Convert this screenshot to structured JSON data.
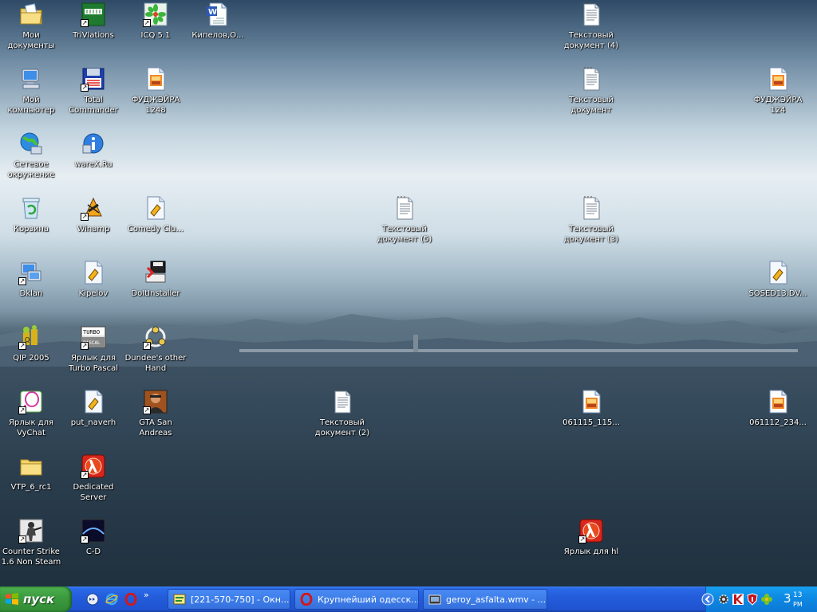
{
  "desktop": {
    "icons": [
      {
        "label": "Мои\nдокументы",
        "icon": "my-documents-icon",
        "shortcut": false
      },
      {
        "label": "Мой\nкомпьютер",
        "icon": "my-computer-icon",
        "shortcut": false
      },
      {
        "label": "Сетевое\nокружение",
        "icon": "network-places-icon",
        "shortcut": false
      },
      {
        "label": "Корзина",
        "icon": "recycle-bin-icon",
        "shortcut": false
      },
      {
        "label": "Dklan",
        "icon": "network-app-icon",
        "shortcut": true
      },
      {
        "label": "QIP 2005",
        "icon": "qip-icon",
        "shortcut": true
      },
      {
        "label": "Ярлык для\nVyChat",
        "icon": "vychat-icon",
        "shortcut": true
      },
      {
        "label": "VTP_6_rc1",
        "icon": "folder-icon",
        "shortcut": false
      },
      {
        "label": "Counter Strike\n1.6 Non Steam",
        "icon": "counter-strike-icon",
        "shortcut": true
      },
      {
        "label": "TriVlations",
        "icon": "trivlations-icon",
        "shortcut": true
      },
      {
        "label": "Total\nCommander",
        "icon": "total-commander-icon",
        "shortcut": true
      },
      {
        "label": "wareX.Ru",
        "icon": "info-globe-icon",
        "shortcut": false
      },
      {
        "label": "Winamp",
        "icon": "winamp-icon",
        "shortcut": true
      },
      {
        "label": "Kipelov",
        "icon": "media-file-icon",
        "shortcut": false
      },
      {
        "label": "Ярлык для\nTurbo Pascal",
        "icon": "turbo-pascal-icon",
        "shortcut": true
      },
      {
        "label": "put_naverh",
        "icon": "media-file-icon",
        "shortcut": false
      },
      {
        "label": "Dedicated\nServer",
        "icon": "half-life-icon",
        "shortcut": true
      },
      {
        "label": "C-D",
        "icon": "c-d-icon",
        "shortcut": true
      },
      {
        "label": "ICQ 5.1",
        "icon": "icq-icon",
        "shortcut": true
      },
      {
        "label": "ФУДЖЭЙРА\n1248",
        "icon": "image-file-icon",
        "shortcut": false
      },
      {
        "label": "Comedy Clu...",
        "icon": "media-file-icon",
        "shortcut": false
      },
      {
        "label": "DoItInstaller",
        "icon": "installer-icon",
        "shortcut": false
      },
      {
        "label": "Dundee's other\nHand",
        "icon": "dundee-icon",
        "shortcut": true
      },
      {
        "label": "GTA San\nAndreas",
        "icon": "gta-icon",
        "shortcut": true
      },
      {
        "label": "Кипелов,О...",
        "icon": "word-document-icon",
        "shortcut": false
      },
      {
        "label": "Текстовый\nдокумент (5)",
        "icon": "text-document-icon",
        "shortcut": false
      },
      {
        "label": "Текстовый\nдокумент (2)",
        "icon": "text-document-icon",
        "shortcut": false
      },
      {
        "label": "Текстовый\nдокумент (4)",
        "icon": "text-document-icon",
        "shortcut": false
      },
      {
        "label": "Текстовый\nдокумент",
        "icon": "text-document-icon",
        "shortcut": false
      },
      {
        "label": "Текстовый\nдокумент (3)",
        "icon": "text-document-icon",
        "shortcut": false
      },
      {
        "label": "061115_115...",
        "icon": "image-file-icon",
        "shortcut": false
      },
      {
        "label": "Ярлык для hl",
        "icon": "half-life-icon",
        "shortcut": true
      },
      {
        "label": "ФУДЖЭЙРА\n124",
        "icon": "image-file-icon",
        "shortcut": false
      },
      {
        "label": "SOSED13.DV...",
        "icon": "media-file-icon",
        "shortcut": false
      },
      {
        "label": "061112_234...",
        "icon": "image-file-icon",
        "shortcut": false
      }
    ]
  },
  "taskbar": {
    "start_label": "пуск",
    "quick_launch": [
      "show-desktop-icon",
      "internet-explorer-icon",
      "opera-icon",
      "more-chevron-icon"
    ],
    "tasks": [
      {
        "label": "[221-570-750] - Окн...",
        "icon": "chat-window-icon"
      },
      {
        "label": "Крупнейший одесск...",
        "icon": "opera-icon"
      },
      {
        "label": "geroy_asfalta.wmv - ...",
        "icon": "media-player-icon"
      }
    ],
    "tray": {
      "icons": [
        "show-hidden-icon",
        "settings-gear-icon",
        "kaspersky-icon",
        "antivirus-shield-icon",
        "qip-flower-icon"
      ],
      "clock_hour": "3",
      "clock_minutes": "13",
      "clock_ampm": "PM"
    }
  },
  "colors": {
    "taskbar_blue": "#245ddb",
    "start_green": "#3c9c3f",
    "tray_blue": "#0f8be4"
  }
}
